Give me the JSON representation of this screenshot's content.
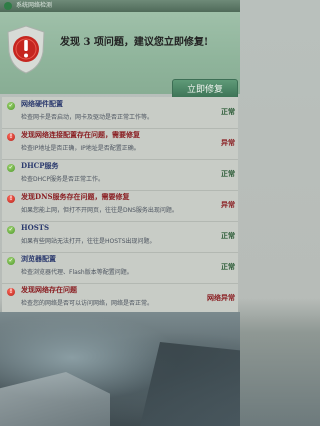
{
  "titlebar": {
    "title": "系统网络检测"
  },
  "header": {
    "title": "发现 3 项问题，建议您立即修复!",
    "fix_button": "立即修复"
  },
  "items": [
    {
      "name": "网络硬件配置",
      "desc": "检查网卡是否启动，网卡及驱动是否正常工作等。",
      "status": "正常",
      "state": "ok"
    },
    {
      "name": "发现网络连接配置存在问题，需要修复",
      "desc": "检查IP地址是否正确，IP地址是否配置正确。",
      "status": "异常",
      "state": "err"
    },
    {
      "name": "DHCP服务",
      "desc": "检查DHCP服务是否正常工作。",
      "status": "正常",
      "state": "ok"
    },
    {
      "name": "发现DNS服务存在问题，需要修复",
      "desc": "如果您能上网，但打不开网页，往往是DNS服务出现问题。",
      "status": "异常",
      "state": "err"
    },
    {
      "name": "HOSTS",
      "desc": "如果有些网站无法打开，往往是HOSTS出现问题。",
      "status": "正常",
      "state": "ok"
    },
    {
      "name": "浏览器配置",
      "desc": "检查浏览器代理、Flash版本等配置问题。",
      "status": "正常",
      "state": "ok"
    },
    {
      "name": "发现网络存在问题",
      "desc": "检查您的网络是否可以访问网络，网络是否正常。",
      "status": "网络异常",
      "state": "err"
    }
  ],
  "colors": {
    "ok": "#4d9a2a",
    "error": "#b4221c",
    "header_bg": "#8fb49b"
  }
}
